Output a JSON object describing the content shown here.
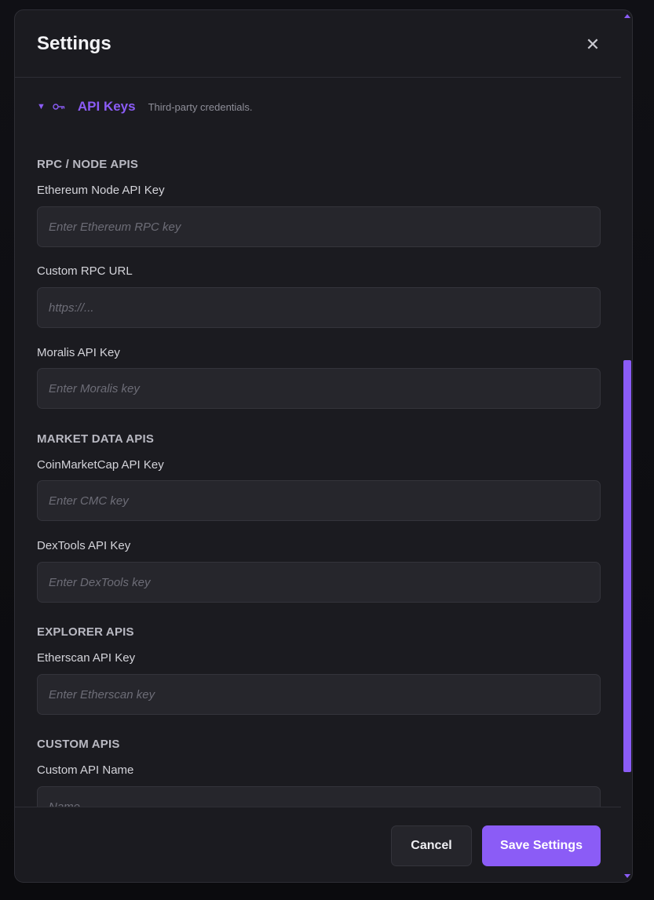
{
  "modal": {
    "title": "Settings",
    "close_glyph": "✕"
  },
  "section": {
    "caret": "▼",
    "icon": "key-icon",
    "name": "API Keys",
    "description": "Third-party credentials."
  },
  "groups": [
    {
      "heading": "RPC / NODE APIS",
      "fields": [
        {
          "label": "Ethereum Node API Key",
          "value": "",
          "placeholder": "Enter Ethereum RPC key"
        },
        {
          "label": "Custom RPC URL",
          "value": "",
          "placeholder": "https://..."
        },
        {
          "label": "Moralis API Key",
          "value": "",
          "placeholder": "Enter Moralis key"
        }
      ]
    },
    {
      "heading": "MARKET DATA APIS",
      "fields": [
        {
          "label": "CoinMarketCap API Key",
          "value": "",
          "placeholder": "Enter CMC key"
        },
        {
          "label": "DexTools API Key",
          "value": "",
          "placeholder": "Enter DexTools key"
        }
      ]
    },
    {
      "heading": "EXPLORER APIS",
      "fields": [
        {
          "label": "Etherscan API Key",
          "value": "",
          "placeholder": "Enter Etherscan key"
        }
      ]
    },
    {
      "heading": "CUSTOM APIS",
      "fields": [
        {
          "label": "Custom API Name",
          "value": "",
          "placeholder": "Name"
        }
      ]
    }
  ],
  "footer": {
    "cancel_label": "Cancel",
    "save_label": "Save Settings"
  },
  "colors": {
    "accent": "#8b5cf6",
    "modal_bg": "#1b1b20",
    "input_bg": "#26262c"
  }
}
